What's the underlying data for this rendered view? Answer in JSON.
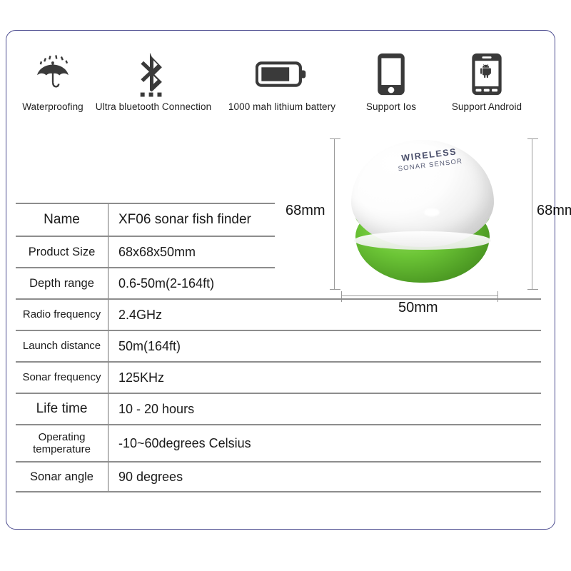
{
  "frame": {
    "border_color": "#4b4b8f"
  },
  "features": [
    {
      "icon": "umbrella-rain-icon",
      "label": "Waterproofing"
    },
    {
      "icon": "bluetooth-icon",
      "label": "Ultra bluetooth Connection"
    },
    {
      "icon": "battery-icon",
      "label": "1000 mah lithium battery"
    },
    {
      "icon": "iphone-icon",
      "label": "Support Ios"
    },
    {
      "icon": "android-phone-icon",
      "label": "Support  Android"
    }
  ],
  "spec_table": {
    "rows": [
      {
        "key": "Name",
        "value": "XF06 sonar fish finder"
      },
      {
        "key": "Product Size",
        "value": "68x68x50mm"
      },
      {
        "key": "Depth range",
        "value": "0.6-50m(2-164ft)"
      },
      {
        "key": "Radio frequency",
        "value": "2.4GHz"
      },
      {
        "key": "Launch distance",
        "value": "50m(164ft)"
      },
      {
        "key": "Sonar frequency",
        "value": "125KHz"
      },
      {
        "key": "Life time",
        "value": "10 - 20 hours"
      },
      {
        "key": "Operating temperature",
        "value": "-10~60degrees Celsius"
      },
      {
        "key": "Sonar angle",
        "value": "90 degrees"
      }
    ]
  },
  "product": {
    "brand_main": "WIRELESS",
    "brand_sub": "SONAR  SENSOR",
    "dimensions": {
      "left": "68mm",
      "right": "68mm",
      "bottom": "50mm"
    },
    "colors": {
      "shell": "#ffffff",
      "base": "#5cbd28"
    }
  }
}
